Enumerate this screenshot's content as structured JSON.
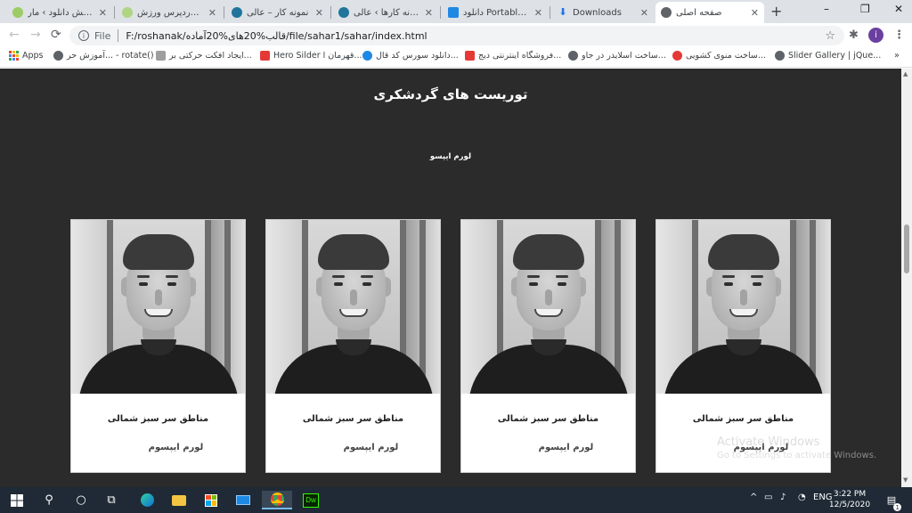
{
  "browser": {
    "tabs": [
      {
        "label": "ویرایش دانلود › مار",
        "active": false
      },
      {
        "label": "قالب وردپرس ورزش",
        "active": false
      },
      {
        "label": "نمونه کار – عالی",
        "active": false
      },
      {
        "label": "نمونه کارها › عالی –",
        "active": false
      },
      {
        "label": "دانلود Portable +",
        "active": false
      },
      {
        "label": "Downloads",
        "active": false
      },
      {
        "label": "صفحه اصلی",
        "active": true
      }
    ],
    "new_tab_label": "+",
    "window_controls": {
      "minimize": "–",
      "restore": "❐",
      "close": "✕"
    },
    "nav": {
      "back": "←",
      "forward": "→",
      "reload": "⟳"
    },
    "address": {
      "scheme_label": "File",
      "url": "F:/roshanak/قالب%20های%20آماده/file/sahar1/sahar/index.html"
    },
    "star": "☆",
    "extensions_icon": "✱",
    "more_icon": "⋮",
    "avatar_letter": "i",
    "bookmarks": [
      {
        "label": "Apps",
        "color": "#ea4335"
      },
      {
        "label": "آموزش حر... - rotate()",
        "color": "#5f6368"
      },
      {
        "label": "ایجاد افکت حرکتی بر...",
        "color": "#5f6368"
      },
      {
        "label": "Hero Silder قهرمان ا...",
        "color": "#e53935"
      },
      {
        "label": "دانلود سورس کد قال...",
        "color": "#1e88e5"
      },
      {
        "label": "فروشگاه اینترنتی دیج...",
        "color": "#e53935"
      },
      {
        "label": "ساخت اسلایدر در جاو...",
        "color": "#5f6368"
      },
      {
        "label": "ساخت منوی کشویی...",
        "color": "#e53935"
      },
      {
        "label": "Slider Gallery | jQue...",
        "color": "#5f6368"
      }
    ],
    "bookmarks_more": "»"
  },
  "page": {
    "heading": "توریست های گردشکری",
    "subheading": "لورم ایپسو",
    "cards": [
      {
        "title": "مناطق سر سبز شمالی",
        "subtitle": "لورم ایپسوم"
      },
      {
        "title": "مناطق سر سبز شمالی",
        "subtitle": "لورم ایپسوم"
      },
      {
        "title": "مناطق سر سبز شمالی",
        "subtitle": "لورم ایپسوم"
      },
      {
        "title": "مناطق سر سبز شمالی",
        "subtitle": "لورم ایپسوم"
      }
    ]
  },
  "watermark": {
    "line1": "Activate Windows",
    "line2": "Go to Settings to activate Windows."
  },
  "taskbar": {
    "start_icon": "windows-logo",
    "search_icon": "⚲",
    "cortana_icon": "○",
    "taskview_icon": "⧉",
    "tray_arrow": "^",
    "language": "ENG",
    "time": "3:22 PM",
    "date": "12/5/2020",
    "notification_badge": "1"
  }
}
